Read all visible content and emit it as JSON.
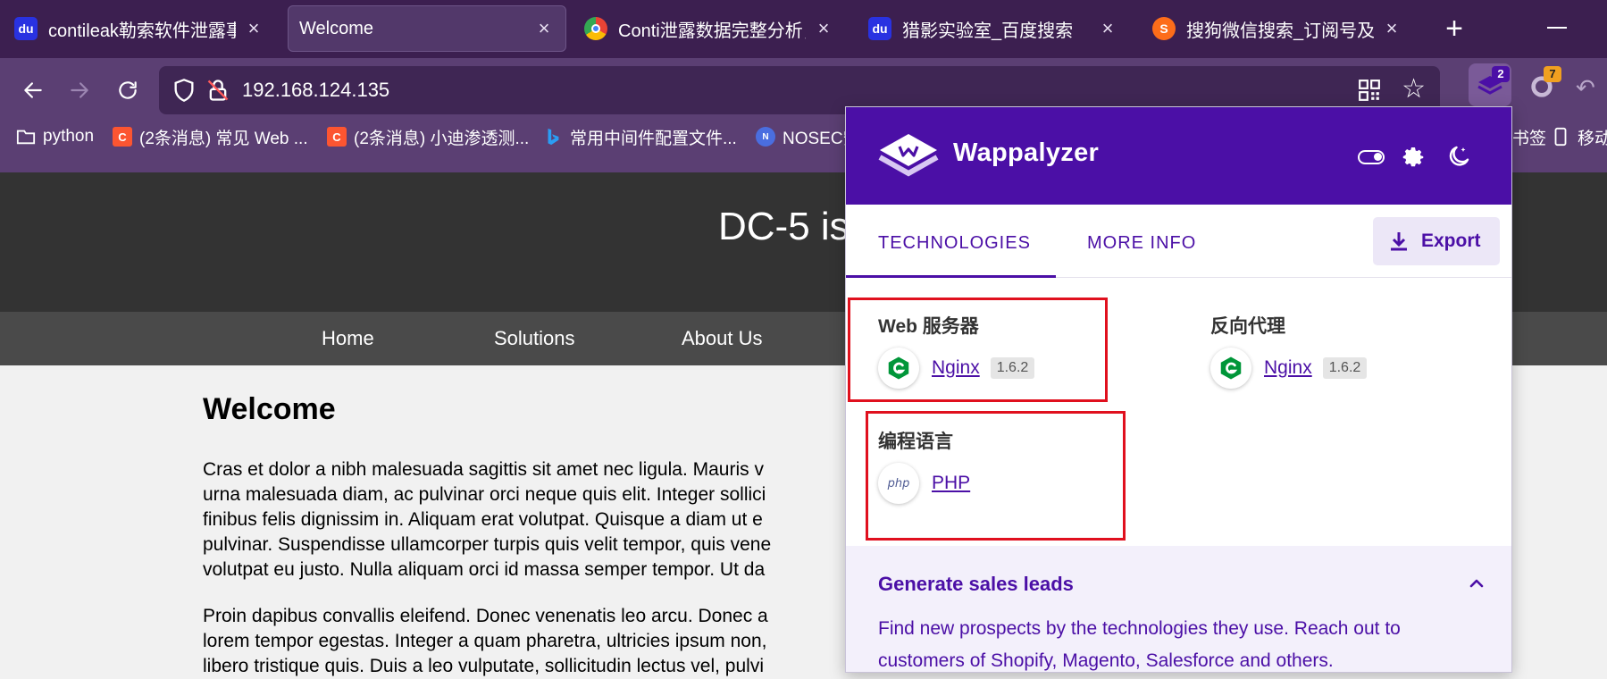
{
  "browser": {
    "tabs": [
      {
        "title": "contileak勒索软件泄露事件_",
        "favicon": "baidu-paw",
        "active": false
      },
      {
        "title": "Welcome",
        "favicon": "",
        "active": true
      },
      {
        "title": "Conti泄露数据完整分析，疑",
        "favicon": "chrome-like",
        "active": false
      },
      {
        "title": "猎影实验室_百度搜索",
        "favicon": "baidu-paw",
        "active": false
      },
      {
        "title": "搜狗微信搜索_订阅号及文章",
        "favicon": "sogou",
        "active": false
      }
    ],
    "close_glyph": "×",
    "new_tab_glyph": "+",
    "url": "192.168.124.135",
    "extensions": {
      "wappalyzer_badge": "2",
      "other_badge": "7"
    },
    "bookmarks": [
      {
        "label": "python",
        "icon": "folder-icon"
      },
      {
        "label": "(2条消息) 常见 Web ...",
        "icon": "csdn-icon"
      },
      {
        "label": "(2条消息) 小迪渗透测...",
        "icon": "csdn-icon"
      },
      {
        "label": "常用中间件配置文件...",
        "icon": "bing-icon"
      },
      {
        "label": "NOSEC安",
        "icon": "nosec-icon"
      },
      {
        "label": "书签",
        "icon": ""
      },
      {
        "label": "移动设",
        "icon": "mobile-icon"
      }
    ],
    "colors": {
      "tabstrip": "#3c1f50",
      "toolbar": "#5b3f73",
      "urlbar": "#3f2654"
    }
  },
  "page": {
    "title": "DC-5 is",
    "nav": [
      "Home",
      "Solutions",
      "About Us"
    ],
    "heading": "Welcome",
    "paragraph1": [
      "Cras et dolor a nibh malesuada sagittis sit amet nec ligula. Mauris v",
      "urna malesuada diam, ac pulvinar orci neque quis elit. Integer sollici",
      "finibus felis dignissim in. Aliquam erat volutpat. Quisque a diam ut e",
      "pulvinar. Suspendisse ullamcorper turpis quis velit tempor, quis vene",
      "volutpat eu justo. Nulla aliquam orci id massa semper tempor. Ut da"
    ],
    "paragraph2": [
      "Proin dapibus convallis eleifend. Donec venenatis leo arcu. Donec a",
      "lorem tempor egestas. Integer a quam pharetra, ultricies ipsum non,",
      "libero tristique quis. Duis a leo vulputate, sollicitudin lectus vel, pulvi"
    ]
  },
  "wappalyzer": {
    "brand": "Wappalyzer",
    "tabs": [
      "TECHNOLOGIES",
      "MORE INFO"
    ],
    "export_label": "Export",
    "categories": [
      {
        "title": "Web 服务器",
        "techs": [
          {
            "name": "Nginx",
            "version": "1.6.2",
            "icon": "nginx-icon"
          }
        ]
      },
      {
        "title": "反向代理",
        "techs": [
          {
            "name": "Nginx",
            "version": "1.6.2",
            "icon": "nginx-icon"
          }
        ]
      },
      {
        "title": "编程语言",
        "techs": [
          {
            "name": "PHP",
            "version": "",
            "icon": "php-icon"
          }
        ]
      }
    ],
    "php_icon_text": "php",
    "leads": {
      "title": "Generate sales leads",
      "text": "Find new prospects by the technologies they use. Reach out to customers of Shopify, Magento, Salesforce and others."
    },
    "colors": {
      "primary": "#4b0fa6",
      "highlight_box": "#e0101e",
      "leads_bg": "#f3f0fb"
    }
  }
}
